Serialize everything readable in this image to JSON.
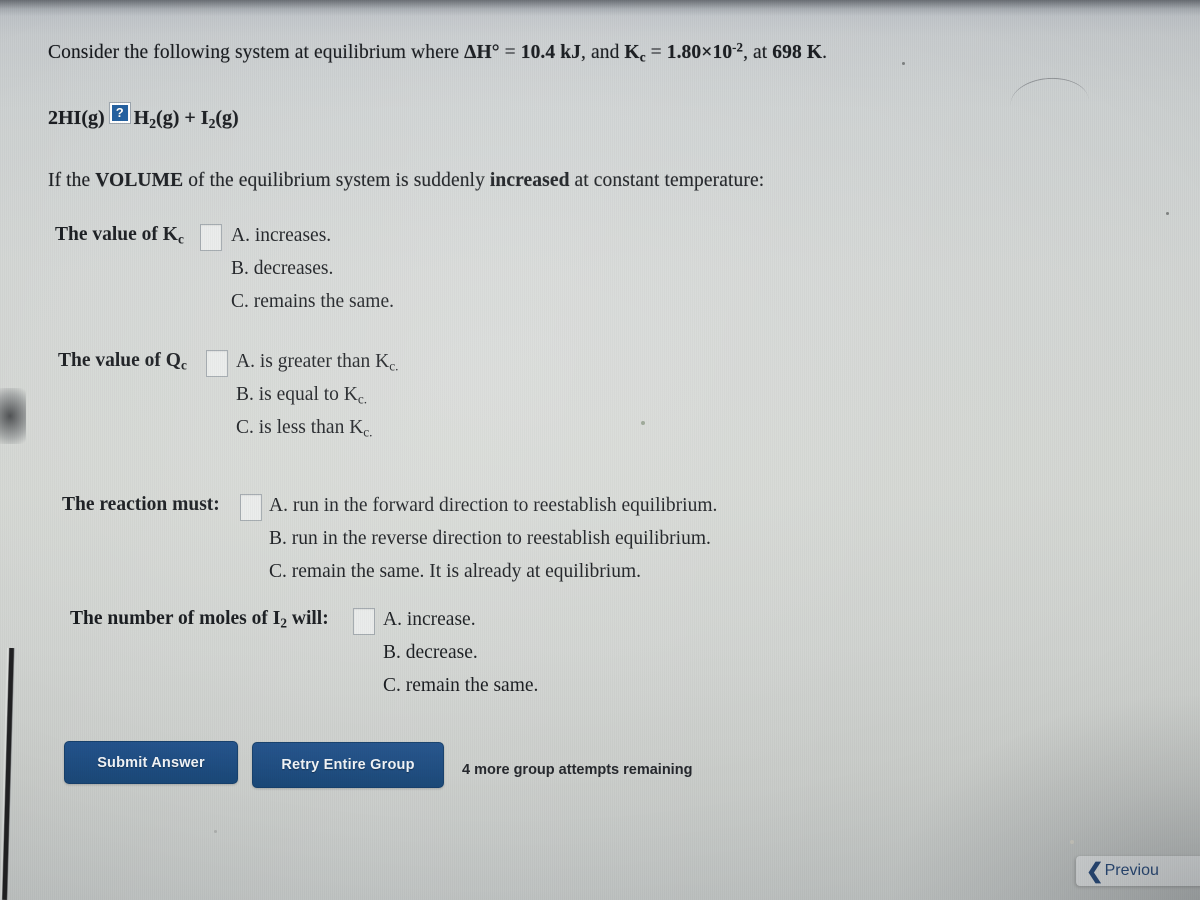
{
  "problem": {
    "intro_prefix": "Consider the following system at equilibrium where ",
    "delta_h_symbol": "ΔH°",
    "delta_h_equals": " = ",
    "delta_h_value": "10.4 kJ",
    "intro_mid": ", and ",
    "kc_symbol": "K",
    "kc_subscript": "c",
    "kc_equals": " = ",
    "kc_value_mantissa": "1.80×10",
    "kc_value_exponent": "-2",
    "intro_suffix": ", at ",
    "temperature": "698 K",
    "intro_end": ".",
    "equation": {
      "reactant": "2HI(g)",
      "arrow_icon": "broken-image-icon",
      "arrow_icon_glyph": "?",
      "product_1_formula": "H",
      "product_1_subscript": "2",
      "product_1_state": "(g)",
      "plus": " + ",
      "product_2_formula": "I",
      "product_2_subscript": "2",
      "product_2_state": "(g)"
    },
    "condition_prefix": "If the ",
    "condition_bold_1": "VOLUME",
    "condition_mid": " of the equilibrium system is suddenly ",
    "condition_bold_2": "increased",
    "condition_suffix": " at constant temperature:"
  },
  "groups": [
    {
      "label_prefix": "The value of K",
      "label_subscript": "c",
      "label_suffix": "",
      "input_value": "",
      "choices": [
        "A. increases.",
        "B. decreases.",
        "C. remains the same."
      ]
    },
    {
      "label_prefix": "The value of Q",
      "label_subscript": "c",
      "label_suffix": "",
      "input_value": "",
      "choices": [
        "A. is greater than K",
        "B. is equal to K",
        "C. is less than K"
      ],
      "choice_subscripts": [
        "c.",
        "c.",
        "c."
      ]
    },
    {
      "label_prefix": "The reaction must:",
      "label_subscript": "",
      "label_suffix": "",
      "input_value": "",
      "choices": [
        "A. run in the forward direction to reestablish equilibrium.",
        "B. run in the reverse direction to reestablish equilibrium.",
        "C. remain the same. It is already at equilibrium."
      ]
    },
    {
      "label_prefix": "The number of moles of I",
      "label_subscript": "2",
      "label_suffix": " will:",
      "input_value": "",
      "choices": [
        "A. increase.",
        "B. decrease.",
        "C. remain the same."
      ]
    }
  ],
  "actions": {
    "submit_label": "Submit Answer",
    "retry_label": "Retry Entire Group",
    "attempts_text": "4 more group attempts remaining",
    "button_color": "#1a4878"
  },
  "navigation": {
    "previous_label": "Previou",
    "previous_chevron": "❮"
  }
}
